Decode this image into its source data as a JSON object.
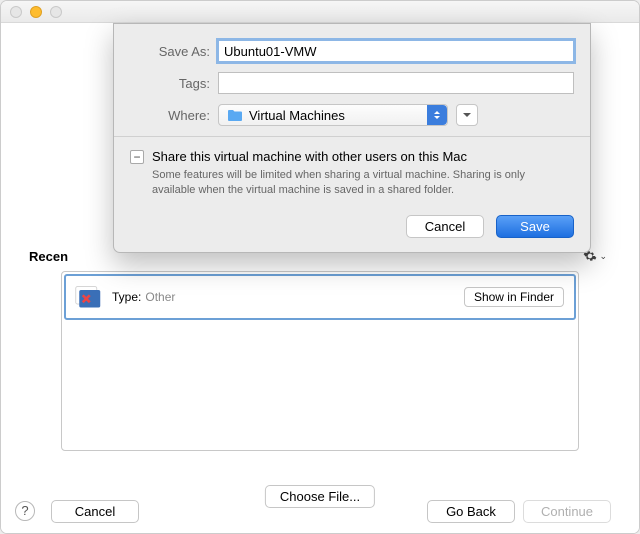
{
  "sheet": {
    "save_as_label": "Save As:",
    "save_as_value": "Ubuntu01-VMW",
    "tags_label": "Tags:",
    "tags_value": "",
    "where_label": "Where:",
    "where_value": "Virtual Machines",
    "share": {
      "title": "Share this virtual machine with other users on this Mac",
      "desc": "Some features will be limited when sharing a virtual machine. Sharing is only available when the virtual machine is saved in a shared folder.",
      "checkbox_state": "−"
    },
    "cancel_label": "Cancel",
    "save_label": "Save"
  },
  "background": {
    "recent_label_partial": "Recen",
    "list": {
      "type_label": "Type:",
      "type_value": "Other",
      "show_in_finder_label": "Show in Finder"
    },
    "choose_file_label": "Choose File...",
    "help_label": "?",
    "cancel_label": "Cancel",
    "go_back_label": "Go Back",
    "continue_label": "Continue"
  }
}
